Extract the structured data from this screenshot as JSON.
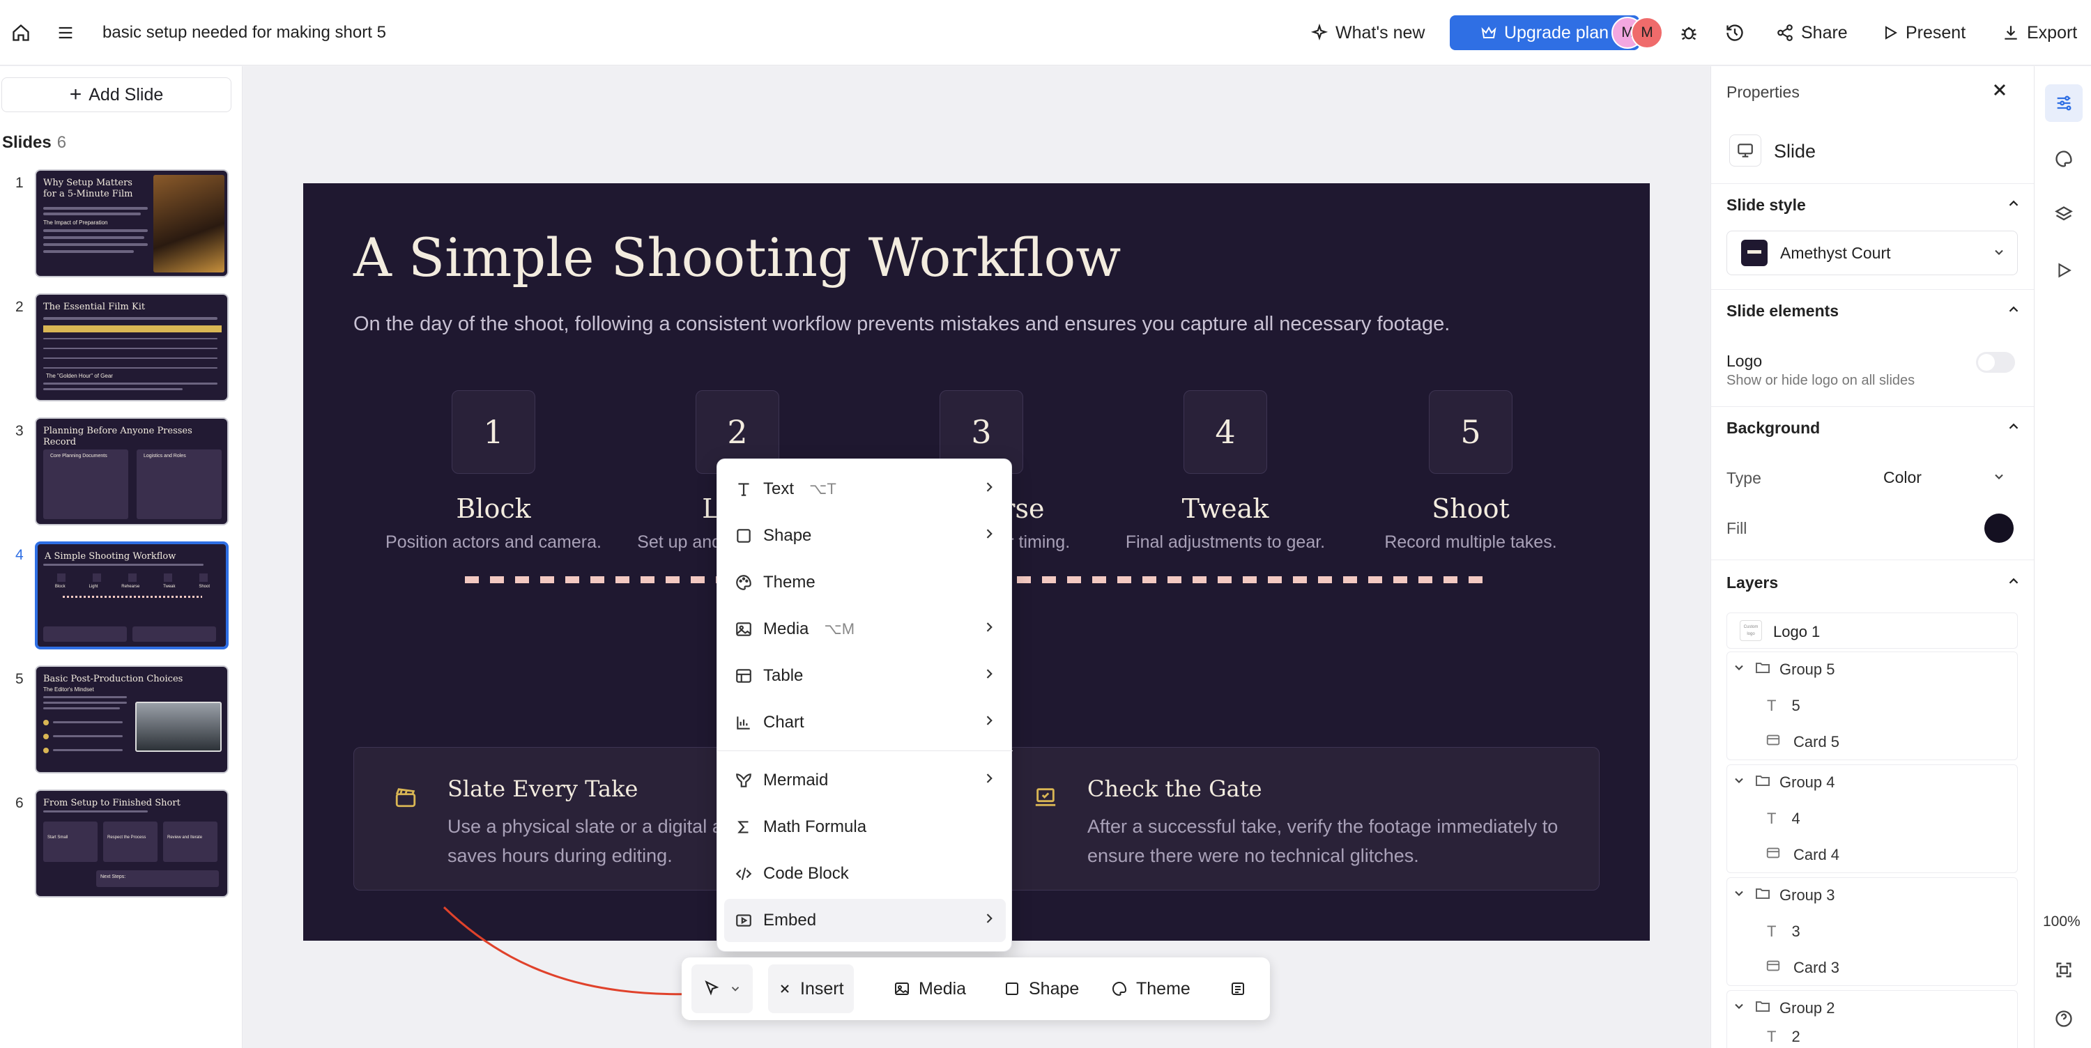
{
  "topbar": {
    "doc_title": "basic setup needed for making short 5",
    "whats_new": "What's new",
    "upgrade": "Upgrade plan",
    "avatars": [
      "M",
      "M"
    ],
    "share": "Share",
    "present": "Present",
    "export": "Export",
    "icons": [
      "home-icon",
      "menu-icon",
      "sparkle-icon",
      "crown-icon",
      "bug-icon",
      "history-icon",
      "share-icon",
      "play-icon",
      "download-icon"
    ]
  },
  "left": {
    "add_slide": "Add Slide",
    "slides_label": "Slides",
    "slides_count": "6",
    "thumbs": [
      {
        "num": "1",
        "title": "Why Setup Matters for a 5-Minute Film",
        "subhead": "The Impact of Preparation"
      },
      {
        "num": "2",
        "title": "The Essential Film Kit",
        "subhead": "The \"Golden Hour\" of Gear"
      },
      {
        "num": "3",
        "title": "Planning Before Anyone Presses Record",
        "col1": "Core Planning Documents",
        "col2": "Logistics and Roles"
      },
      {
        "num": "4",
        "title": "A Simple Shooting Workflow",
        "steps": [
          "Block",
          "Light",
          "Rehearse",
          "Tweak",
          "Shoot"
        ]
      },
      {
        "num": "5",
        "title": "Basic Post-Production Choices",
        "subhead": "The Editor's Mindset"
      },
      {
        "num": "6",
        "title": "From Setup to Finished Short",
        "cols": [
          "Start Small",
          "Respect the Process",
          "Review and Iterate"
        ],
        "footer": "Next Steps:"
      }
    ]
  },
  "slide": {
    "title": "A Simple Shooting Workflow",
    "subtitle": "On the day of the shoot, following a consistent workflow prevents mistakes and ensures you capture all necessary footage.",
    "steps": [
      {
        "num": "1",
        "name": "Block",
        "desc": "Position actors and camera."
      },
      {
        "num": "2",
        "name": "Light",
        "desc": "Set up and adjust lighting."
      },
      {
        "num": "3",
        "name": "Rehearse",
        "desc": "Run through for timing."
      },
      {
        "num": "4",
        "name": "Tweak",
        "desc": "Final adjustments to gear."
      },
      {
        "num": "5",
        "name": "Shoot",
        "desc": "Record multiple takes."
      }
    ],
    "cards": [
      {
        "title": "Slate Every Take",
        "line1": "Use a physical slate or a digital app.",
        "line2": "saves hours during editing.",
        "icon": "clapperboard-icon"
      },
      {
        "title": "Check the Gate",
        "line1": "After a successful take, verify the footage immediately to",
        "line2": "ensure there were no technical glitches.",
        "icon": "laptop-check-icon"
      }
    ]
  },
  "insert_menu": {
    "items": [
      {
        "label": "Text",
        "shortcut": "⌥T",
        "submenu": true,
        "icon": "text-icon"
      },
      {
        "label": "Shape",
        "shortcut": "",
        "submenu": true,
        "icon": "square-icon"
      },
      {
        "label": "Theme",
        "shortcut": "",
        "submenu": false,
        "icon": "palette-icon"
      },
      {
        "label": "Media",
        "shortcut": "⌥M",
        "submenu": true,
        "icon": "image-icon"
      },
      {
        "label": "Table",
        "shortcut": "",
        "submenu": true,
        "icon": "table-icon"
      },
      {
        "label": "Chart",
        "shortcut": "",
        "submenu": true,
        "icon": "chart-icon"
      },
      {
        "label": "Mermaid",
        "shortcut": "",
        "submenu": true,
        "icon": "mermaid-icon"
      },
      {
        "label": "Math Formula",
        "shortcut": "",
        "submenu": false,
        "icon": "sigma-icon"
      },
      {
        "label": "Code Block",
        "shortcut": "",
        "submenu": false,
        "icon": "code-icon"
      },
      {
        "label": "Embed",
        "shortcut": "",
        "submenu": true,
        "icon": "embed-icon"
      }
    ]
  },
  "toolbar": {
    "insert": "Insert",
    "media": "Media",
    "shape": "Shape",
    "theme": "Theme"
  },
  "properties": {
    "title": "Properties",
    "slide_label": "Slide",
    "slide_style": "Slide style",
    "style_value": "Amethyst Court",
    "slide_elements": "Slide elements",
    "logo_label": "Logo",
    "logo_desc": "Show or hide logo on all slides",
    "logo_enabled": false,
    "background": "Background",
    "type_label": "Type",
    "type_value": "Color",
    "fill_label": "Fill",
    "fill_color": "#141021",
    "layers_title": "Layers",
    "logo_thumb_text": "Custom logo",
    "layers": {
      "logo": "Logo 1",
      "groups": [
        {
          "name": "Group 5",
          "children": [
            "5",
            "Card 5"
          ]
        },
        {
          "name": "Group 4",
          "children": [
            "4",
            "Card 4"
          ]
        },
        {
          "name": "Group 3",
          "children": [
            "3",
            "Card 3"
          ]
        },
        {
          "name": "Group 2",
          "children": [
            "2"
          ]
        }
      ]
    }
  },
  "rail": {
    "zoom": "100%"
  },
  "colors": {
    "accent": "#2f6fe4",
    "slide_bg": "#1f1830",
    "card_bg": "#2a2238",
    "gold": "#d9b654",
    "dash": "#f3c9c2",
    "arrow": "#e0422b"
  }
}
